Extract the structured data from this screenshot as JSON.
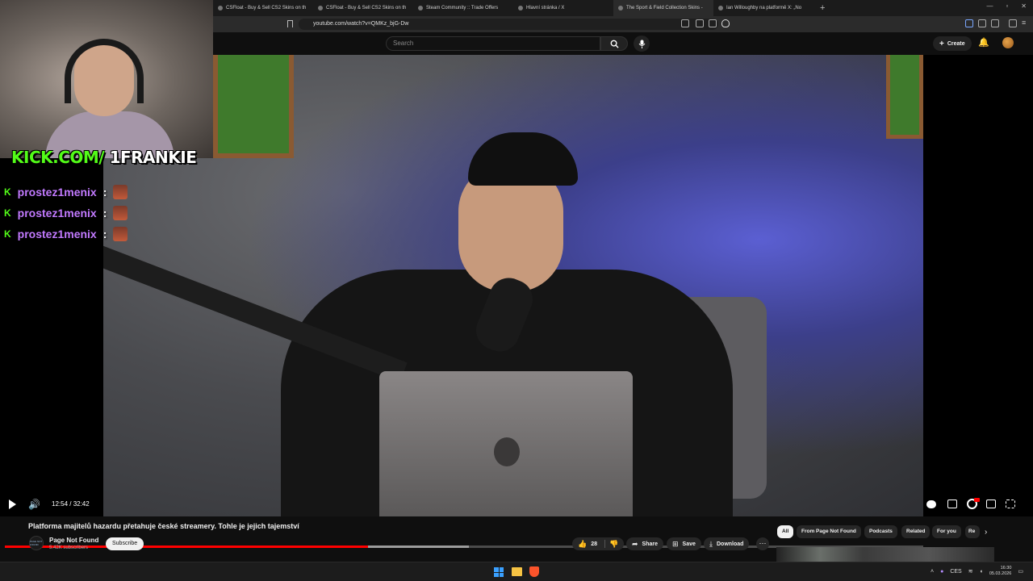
{
  "browser": {
    "tabs": [
      {
        "title": "CSFloat - Buy & Sell CS2 Skins on th",
        "active": false
      },
      {
        "title": "CSFloat - Buy & Sell CS2 Skins on th",
        "active": false
      },
      {
        "title": "Steam Community :: Trade Offers",
        "active": false
      },
      {
        "title": "Hlavní stránka / X",
        "active": false
      },
      {
        "title": "The Sport & Field Collection Skins -",
        "active": true
      },
      {
        "title": "Ian Willoughby na platformě X: „No",
        "active": false
      }
    ],
    "new_tab": "+",
    "url": "youtube.com/watch?v=QMKz_bjG-Dw"
  },
  "youtube": {
    "search_placeholder": "Search",
    "create_label": "Create"
  },
  "overlay": {
    "kick_prefix": "KICK.COM/",
    "kick_channel": " 1FRANKIE",
    "chat": [
      {
        "badge": "K",
        "user": "prostez1menix",
        "colon": ":"
      },
      {
        "badge": "K",
        "user": "prostez1menix",
        "colon": ":"
      },
      {
        "badge": "K",
        "user": "prostez1menix",
        "colon": ":"
      }
    ]
  },
  "player": {
    "time_display": "12:54 / 32:42",
    "progress_fraction": 0.395,
    "buffer_fraction": 0.505
  },
  "video": {
    "title": "Platforma majitelů hazardu přetahuje české streamery. Tohle je jejich tajemství",
    "channel_name": "Page Not Found",
    "channel_avatar_text": "PAGE NOT FOUND",
    "subscribers": "5.42K subscribers",
    "subscribe_label": "Subscribe",
    "likes": "28",
    "share_label": "Share",
    "save_label": "Save",
    "download_label": "Download"
  },
  "chips": [
    "All",
    "From Page Not Found",
    "Podcasts",
    "Related",
    "For you",
    "Re"
  ],
  "taskbar": {
    "lang": "CES",
    "time": "16:30",
    "date": "05.03.2026"
  },
  "colors": {
    "youtube_red": "#ff0000",
    "kick_green": "#53fc18",
    "chat_user": "#c27aff"
  }
}
